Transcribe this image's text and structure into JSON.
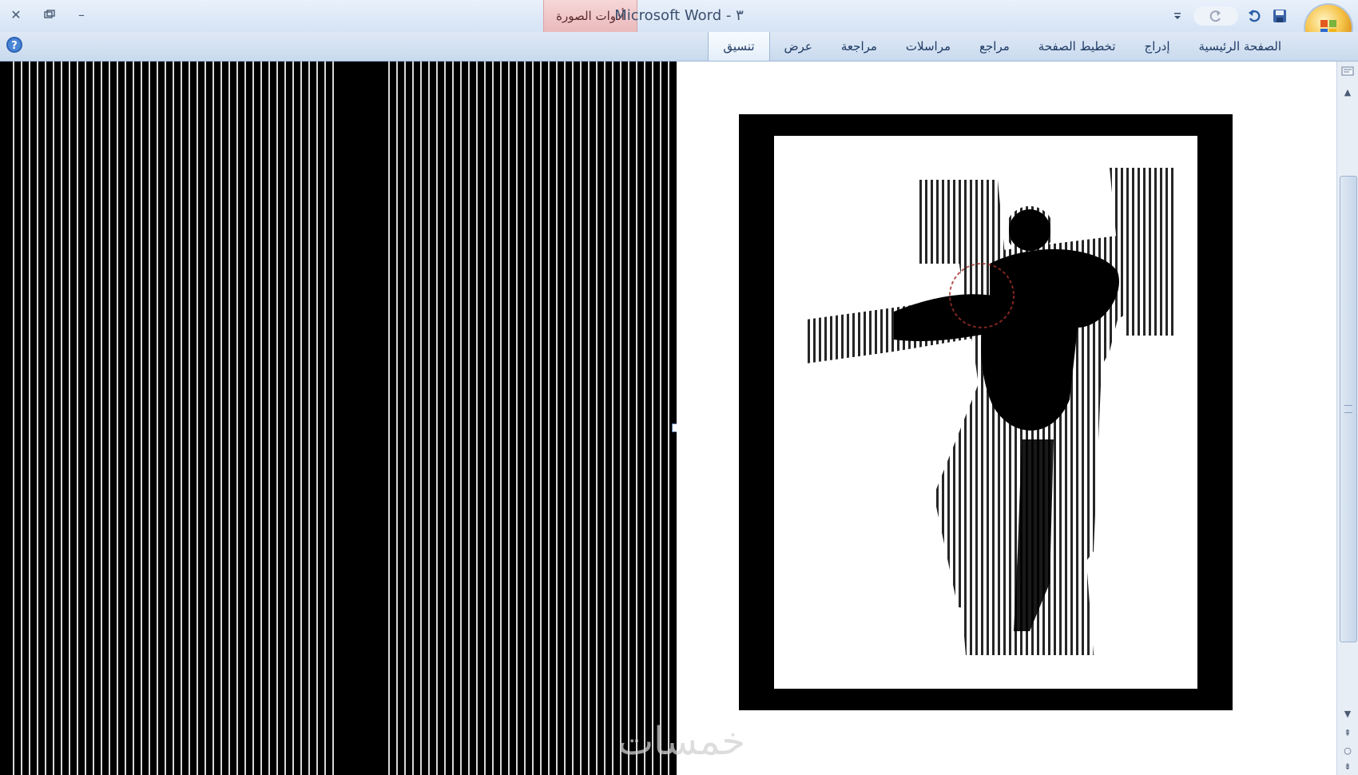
{
  "window": {
    "title": "Microsoft Word - ٣",
    "controls": {
      "close_icon": "close-icon",
      "restore_icon": "restore-icon",
      "minimize_icon": "minimize-icon"
    }
  },
  "context_tab": {
    "label": "أدوات الصورة"
  },
  "quick_access": {
    "icons": [
      "save-icon",
      "undo-icon",
      "redo-icon",
      "customize-icon"
    ]
  },
  "ribbon": {
    "tabs": [
      {
        "label": "الصفحة الرئيسية"
      },
      {
        "label": "إدراج"
      },
      {
        "label": "تخطيط الصفحة"
      },
      {
        "label": "مراجع"
      },
      {
        "label": "مراسلات"
      },
      {
        "label": "مراجعة"
      },
      {
        "label": "عرض"
      },
      {
        "label": "تنسيق"
      }
    ]
  },
  "watermark": "خمسات",
  "colors": {
    "title_bar": "#d5e3f4",
    "context_tab": "#eab9bb",
    "ribbon": "#c9daee",
    "page_black": "#000000"
  }
}
